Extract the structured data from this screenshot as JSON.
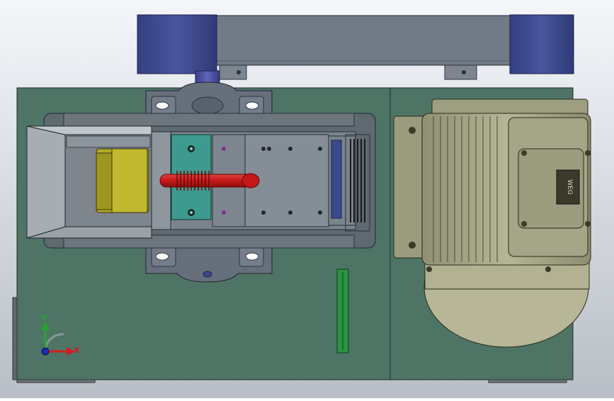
{
  "view": {
    "background_top": "#f4f6fa",
    "background_bottom": "#b9bec6"
  },
  "triad": {
    "x_label": "X",
    "y_label": "Y",
    "x_color": "#d21e1e",
    "y_color": "#1ea82a",
    "z_color": "#1e2ab4"
  },
  "motor": {
    "nameplate_text": "WEG"
  },
  "colors": {
    "base_plate": "#4e7466",
    "top_beam": "#717a86",
    "end_caps": "#3f4a8c",
    "bearing_blocks": "#66707c",
    "motor_body": "#a9a98a",
    "feed_hopper": "#7d858d",
    "yellow_block": "#b4aa28",
    "teal_plate": "#3e9a8e",
    "red_shaft": "#c81e1e",
    "blue_shaft": "#4e53a8",
    "coupling": "#8c2a90",
    "green_bar": "#2c9440"
  }
}
